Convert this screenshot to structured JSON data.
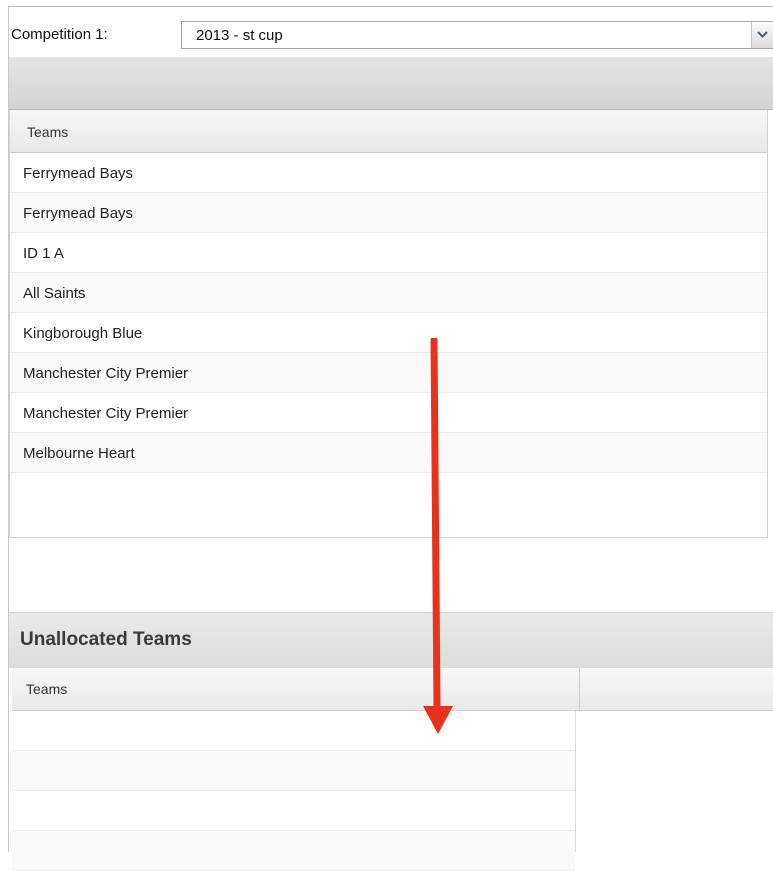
{
  "competition": {
    "label": "Competition 1:",
    "selected": "2013 - st cup"
  },
  "teams_grid": {
    "header": "Teams",
    "rows": [
      "Ferrymead Bays",
      "Ferrymead Bays",
      "ID 1 A",
      "All Saints",
      "Kingborough Blue",
      "Manchester City Premier",
      "Manchester City Premier",
      "Melbourne Heart"
    ]
  },
  "unallocated": {
    "title": "Unallocated Teams",
    "header": "Teams",
    "rows": [
      "",
      "",
      "",
      ""
    ]
  },
  "colors": {
    "annotation_arrow": "#e8321c",
    "panel_gray": "#d9d9d9",
    "accent_line": "#9fb8d6"
  },
  "icons": {
    "dropdown": "chevron-down-icon",
    "annotation": "arrow-down-icon"
  }
}
